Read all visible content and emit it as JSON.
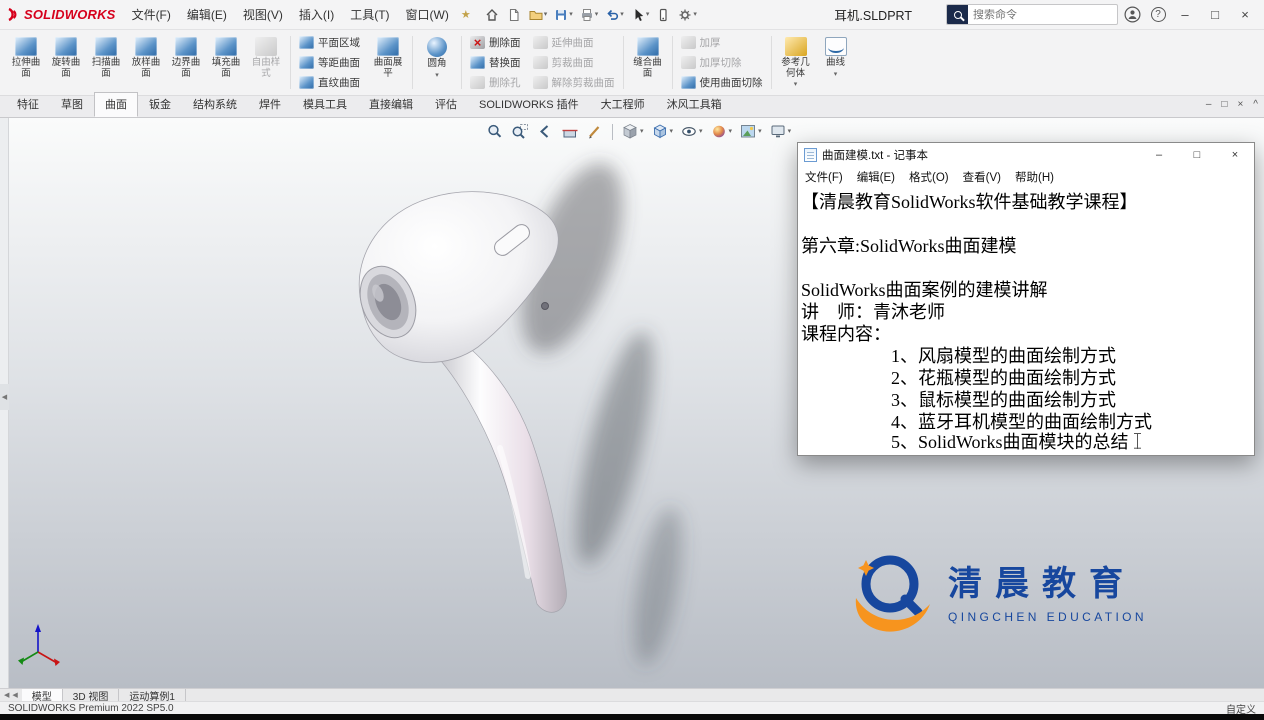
{
  "icons": {
    "caret": "▾",
    "minus": "–",
    "square": "□",
    "close": "×",
    "collapse": "^",
    "help": "?",
    "star": "★",
    "left_arrow": "◀"
  },
  "titlebar": {
    "logo": "SOLIDWORKS",
    "menus": [
      "文件(F)",
      "编辑(E)",
      "视图(V)",
      "插入(I)",
      "工具(T)",
      "窗口(W)"
    ],
    "doc_title": "耳机.SLDPRT",
    "search_placeholder": "搜索命令"
  },
  "ribbon": {
    "groups": [
      {
        "items": [
          {
            "label": "拉伸曲面",
            "enabled": true
          },
          {
            "label": "旋转曲面",
            "enabled": true
          },
          {
            "label": "扫描曲面",
            "enabled": true
          },
          {
            "label": "放样曲面",
            "enabled": true
          },
          {
            "label": "边界曲面",
            "enabled": true
          },
          {
            "label": "填充曲面",
            "enabled": true
          },
          {
            "label": "自由样式",
            "enabled": false
          }
        ]
      },
      {
        "items": [
          {
            "label": "平面区域",
            "enabled": true
          },
          {
            "label": "等距曲面",
            "enabled": true
          },
          {
            "label": "直纹曲面",
            "enabled": true
          }
        ]
      },
      {
        "items": [
          {
            "label": "曲面展平",
            "enabled": true
          }
        ]
      },
      {
        "items": [
          {
            "label": "圆角",
            "enabled": true
          }
        ]
      },
      {
        "items": [
          {
            "label": "删除面",
            "enabled": true
          },
          {
            "label": "替换面",
            "enabled": true
          },
          {
            "label": "删除孔",
            "enabled": false
          }
        ]
      },
      {
        "items": [
          {
            "label": "延伸曲面",
            "enabled": false
          },
          {
            "label": "剪裁曲面",
            "enabled": false
          },
          {
            "label": "解除剪裁曲面",
            "enabled": false
          }
        ]
      },
      {
        "items": [
          {
            "label": "缝合曲面",
            "enabled": true
          }
        ]
      },
      {
        "items": [
          {
            "label": "加厚",
            "enabled": false
          },
          {
            "label": "加厚切除",
            "enabled": false
          },
          {
            "label": "使用曲面切除",
            "enabled": true
          }
        ]
      },
      {
        "items": [
          {
            "label": "参考几何体",
            "enabled": true
          },
          {
            "label": "曲线",
            "enabled": true
          }
        ]
      }
    ]
  },
  "command_tabs": {
    "items": [
      "特征",
      "草图",
      "曲面",
      "钣金",
      "结构系统",
      "焊件",
      "模具工具",
      "直接编辑",
      "评估",
      "SOLIDWORKS 插件",
      "大工程师",
      "沐风工具箱"
    ],
    "active": "曲面"
  },
  "notepad": {
    "title": "曲面建模.txt - 记事本",
    "menus": [
      "文件(F)",
      "编辑(E)",
      "格式(O)",
      "查看(V)",
      "帮助(H)"
    ],
    "lines": [
      "【清晨教育SolidWorks软件基础教学课程】",
      "",
      "第六章:SolidWorks曲面建模",
      "",
      "SolidWorks曲面案例的建模讲解",
      "讲　师：青沐老师",
      "课程内容：",
      "　　　　　1、风扇模型的曲面绘制方式",
      "　　　　　2、花瓶模型的曲面绘制方式",
      "　　　　　3、鼠标模型的曲面绘制方式",
      "　　　　　4、蓝牙耳机模型的曲面绘制方式",
      "　　　　　5、SolidWorks曲面模块的总结"
    ]
  },
  "watermark": {
    "cn": "清晨教育",
    "en": "QINGCHEN EDUCATION"
  },
  "model_tabs": {
    "items": [
      "模型",
      "3D 视图",
      "运动算例1"
    ],
    "active": "模型"
  },
  "statusbar": {
    "left": "SOLIDWORKS Premium 2022 SP5.0",
    "right": "自定义"
  },
  "colors": {
    "brand_red": "#d6001c",
    "brand_blue": "#17479e",
    "brand_orange": "#f7941e",
    "disabled_text": "#a6a6a8"
  }
}
